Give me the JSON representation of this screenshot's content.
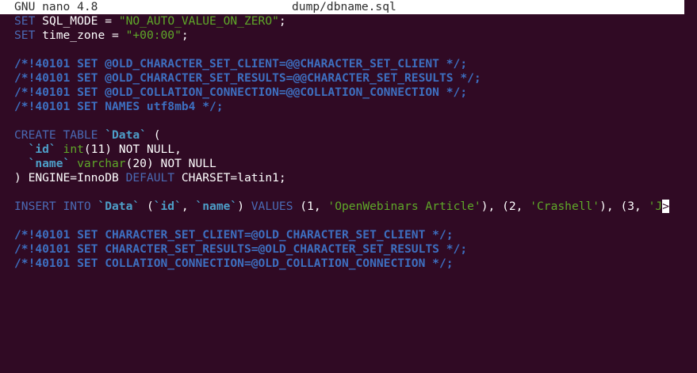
{
  "titlebar": {
    "app": "GNU nano 4.8",
    "file": "dump/dbname.sql"
  },
  "lines": {
    "l1": {
      "a": "SET ",
      "b": "SQL_MODE = ",
      "c": "\"NO_AUTO_VALUE_ON_ZERO\"",
      "d": ";"
    },
    "l2": {
      "a": "SET ",
      "b": "time_zone = ",
      "c": "\"+00:00\"",
      "d": ";"
    },
    "l4": "/*!40101 SET @OLD_CHARACTER_SET_CLIENT=@@CHARACTER_SET_CLIENT */;",
    "l5": "/*!40101 SET @OLD_CHARACTER_SET_RESULTS=@@CHARACTER_SET_RESULTS */;",
    "l6": "/*!40101 SET @OLD_COLLATION_CONNECTION=@@COLLATION_CONNECTION */;",
    "l7": "/*!40101 SET NAMES utf8mb4 */;",
    "l9": {
      "a": "CREATE TABLE ",
      "b": "`Data`",
      "c": " ("
    },
    "l10": {
      "a": "  ",
      "b": "`id`",
      "c": " ",
      "d": "int",
      "e": "(11) NOT NULL,"
    },
    "l11": {
      "a": "  ",
      "b": "`name`",
      "c": " ",
      "d": "varchar",
      "e": "(20) NOT NULL"
    },
    "l12": {
      "a": ") ENGINE=InnoDB ",
      "b": "DEFAULT",
      "c": " CHARSET=latin1;"
    },
    "l14": {
      "a": "INSERT INTO ",
      "b": "`Data`",
      "c": " (",
      "d": "`id`",
      "e": ", ",
      "f": "`name`",
      "g": ") ",
      "h": "VALUES",
      "i": " (1, ",
      "j": "'OpenWebinars Article'",
      "k": "), (2, ",
      "l": "'Crashell'",
      "m": "), (3, ",
      "n": "'J",
      "o": ">"
    },
    "l16": "/*!40101 SET CHARACTER_SET_CLIENT=@OLD_CHARACTER_SET_CLIENT */;",
    "l17": "/*!40101 SET CHARACTER_SET_RESULTS=@OLD_CHARACTER_SET_RESULTS */;",
    "l18": "/*!40101 SET COLLATION_CONNECTION=@OLD_COLLATION_CONNECTION */;"
  },
  "colors": {
    "background": "#300a24",
    "keyword": "#4a6ab4",
    "comment": "#3d6fc0",
    "string": "#5fa829",
    "identifier": "#4d9ec8",
    "text": "#ffffff"
  }
}
